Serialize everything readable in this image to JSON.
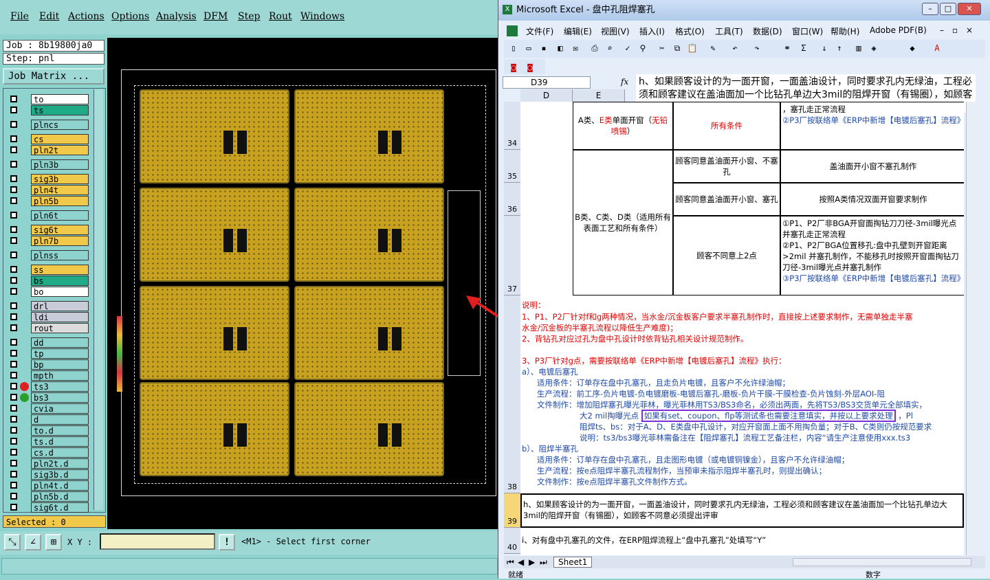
{
  "cam": {
    "menu": [
      "File",
      "Edit",
      "Actions",
      "Options",
      "Analysis",
      "DFM",
      "Step",
      "Rout",
      "Windows"
    ],
    "job_label": "Job : 8b19800ja0",
    "step_label": "Step: pnl",
    "job_matrix_label": "Job Matrix ...",
    "layers": [
      {
        "name": "to",
        "color": "#ffffff"
      },
      {
        "name": "ts",
        "color": "#1faa88"
      },
      {
        "name": "plncs",
        "color": "#8fd3cf"
      },
      {
        "name": "cs",
        "color": "#f0c94a"
      },
      {
        "name": "pln2t",
        "color": "#f0c94a"
      },
      {
        "name": "pln3b",
        "color": "#8fd3cf"
      },
      {
        "name": "sig3b",
        "color": "#f0c94a"
      },
      {
        "name": "pln4t",
        "color": "#f0c94a"
      },
      {
        "name": "pln5b",
        "color": "#f0c94a"
      },
      {
        "name": "pln6t",
        "color": "#8fd3cf"
      },
      {
        "name": "sig6t",
        "color": "#f0c94a"
      },
      {
        "name": "pln7b",
        "color": "#f0c94a"
      },
      {
        "name": "plnss",
        "color": "#8fd3cf"
      },
      {
        "name": "ss",
        "color": "#f0c94a"
      },
      {
        "name": "bs",
        "color": "#1faa88"
      },
      {
        "name": "bo",
        "color": "#ffffff"
      },
      {
        "name": "drl",
        "color": "#c8ccd8"
      },
      {
        "name": "ldi",
        "color": "#c8ccd8"
      },
      {
        "name": "rout",
        "color": "#dcdcdc"
      },
      {
        "name": "dd",
        "color": "#8fd3cf"
      },
      {
        "name": "tp",
        "color": "#8fd3cf"
      },
      {
        "name": "bp",
        "color": "#8fd3cf"
      },
      {
        "name": "mpth",
        "color": "#8fd3cf"
      },
      {
        "name": "ts3",
        "color": "#8fd3cf"
      },
      {
        "name": "bs3",
        "color": "#8fd3cf"
      },
      {
        "name": "cvia",
        "color": "#8fd3cf"
      },
      {
        "name": "d",
        "color": "#8fd3cf"
      },
      {
        "name": "to.d",
        "color": "#8fd3cf"
      },
      {
        "name": "ts.d",
        "color": "#8fd3cf"
      },
      {
        "name": "cs.d",
        "color": "#8fd3cf"
      },
      {
        "name": "pln2t.d",
        "color": "#8fd3cf"
      },
      {
        "name": "sig3b.d",
        "color": "#8fd3cf"
      },
      {
        "name": "pln4t.d",
        "color": "#8fd3cf"
      },
      {
        "name": "pln5b.d",
        "color": "#8fd3cf"
      },
      {
        "name": "sig6t.d",
        "color": "#8fd3cf"
      }
    ],
    "selected_label": "Selected : 0",
    "xy_label": "X Y :",
    "xy_value": "",
    "status_message": "<M1> - Select first corner",
    "alert_icon": "!"
  },
  "excel": {
    "title": "Microsoft Excel - 盘中孔阻焊塞孔",
    "menu": [
      "文件(F)",
      "编辑(E)",
      "视图(V)",
      "插入(I)",
      "格式(O)",
      "工具(T)",
      "数据(D)",
      "窗口(W)",
      "帮助(H)",
      "Adobe PDF(B)"
    ],
    "name_box": "D39",
    "fx": "fx",
    "formula": "h、如果顾客设计的为一面开窗，一面盖油设计，同时要求孔内无绿油，工程必须和顾客建议在盖油面加一个比钻孔单边大3mil的阻焊开窗（有锡圈），如顾客不同意必须提出评审",
    "columns": [
      "D",
      "E"
    ],
    "rows": [
      "34",
      "35",
      "36",
      "37",
      "38",
      "39",
      "40"
    ],
    "cells": {
      "r34_a1": "A类、",
      "r34_a2": "E类",
      "r34_a3": "单面开窗（",
      "r34_a4": "无铅喷锡",
      "r34_a5": "）",
      "r34_cond": "所有条件",
      "r34_top": "，塞孔走正常流程",
      "r34_p3": "②P3厂按联络单《ERP中新增【电镀后塞孔】流程》",
      "r35_d": "B类、C类、D类（适用所有表面工艺和所有条件）",
      "r35_cond": "顾客同意盖油面开小窗、不塞孔",
      "r35_act": "盖油面开小窗不塞孔制作",
      "r36_cond": "顾客同意盖油面开小窗、塞孔",
      "r36_act": "按照A类情况双面开窗要求制作",
      "r37_cond": "顾客不同意上2点",
      "r37_l1": "①P1、P2厂非BGA开窗面掏钻刀刀径-3mil曝光点并塞孔走正常流程",
      "r37_l2": "②P1、P2厂BGA位置移孔:盘中孔壁到开窗距离>2mil 并塞孔制作，不能移孔时按照开窗面掏钻刀刀径-3mil曝光点并塞孔制作",
      "r37_l3": "③P3厂按联络单《ERP中新增【电镀后塞孔】流程》"
    },
    "notes": {
      "title": "说明：",
      "n1": "1、P1、P2厂针对f和g两种情况，当水金/沉金板客户要求半塞孔制作时，直接按上述要求制作，无需单独走半塞",
      "n1b": "水金/沉金板的半塞孔流程以降低生产难度)；",
      "n2": "2、背钻孔对应过孔为盘中孔设计时依背钻孔相关设计规范制作。",
      "n3": "3、P3厂针对g点，需要按联络单《ERP中新增【电镀后塞孔】流程》执行：",
      "a": "a）、电镀后塞孔",
      "a1": "适用条件：订单存在盘中孔塞孔，且走负片电镀，且客户不允许绿油帽；",
      "a2": "生产流程：前工序-负片电镀-负电镀磨板-电镀后塞孔-磨板-负片干膜-干膜检查-负片蚀刻-外层AOI-阻",
      "a3": "文件制作：增加阻焊塞孔曝光菲林，曝光菲林用TS3/BS3命名，必须出两面，先将TS3/BS3交货单元全部填实，",
      "a4": "大2 mil掏曝光点",
      "a4box": "如果有set、coupon、flp等测试条也需要注意填实，并按以上要求处理",
      "a4end": "，Pl",
      "a5": "阻焊ts、bs：对于A、D、E类盘中孔设计，对应开窗面上面不用掏负量；对于B、C类则仍按规范要求",
      "a6": "说明：ts3/bs3曝光菲林需备注在【阻焊塞孔】流程工艺备注栏，内容“请生产注意使用xxx.ts3",
      "b": "b）、阻焊半塞孔",
      "b1": "适用条件：订单存在盘中孔塞孔，且走图形电镀（或电镀铜镍金），且客户不允许绿油帽；",
      "b2": "生产流程：按e点阻焊半塞孔流程制作，当预审未指示阻焊半塞孔时，则提出确认；",
      "b3": "文件制作：按e点阻焊半塞孔文件制作方式。"
    },
    "row39": "h、如果顾客设计的为一面开窗，一面盖油设计，同时要求孔内无绿油，工程必须和顾客建议在盖油面加一个比钻孔单边大3mil的阻焊开窗（有锡圈），如顾客不同意必须提出评审",
    "row40": "i、对有盘中孔塞孔的文件，在ERP阻焊流程上“盘中孔塞孔”处填写“Y”",
    "sheet_tab": "Sheet1",
    "status_left": "就绪",
    "status_right": "数字",
    "accent_red": "#e00000",
    "accent_blue": "#1f4aa8",
    "highlight_purple": "#7b2fd6"
  }
}
